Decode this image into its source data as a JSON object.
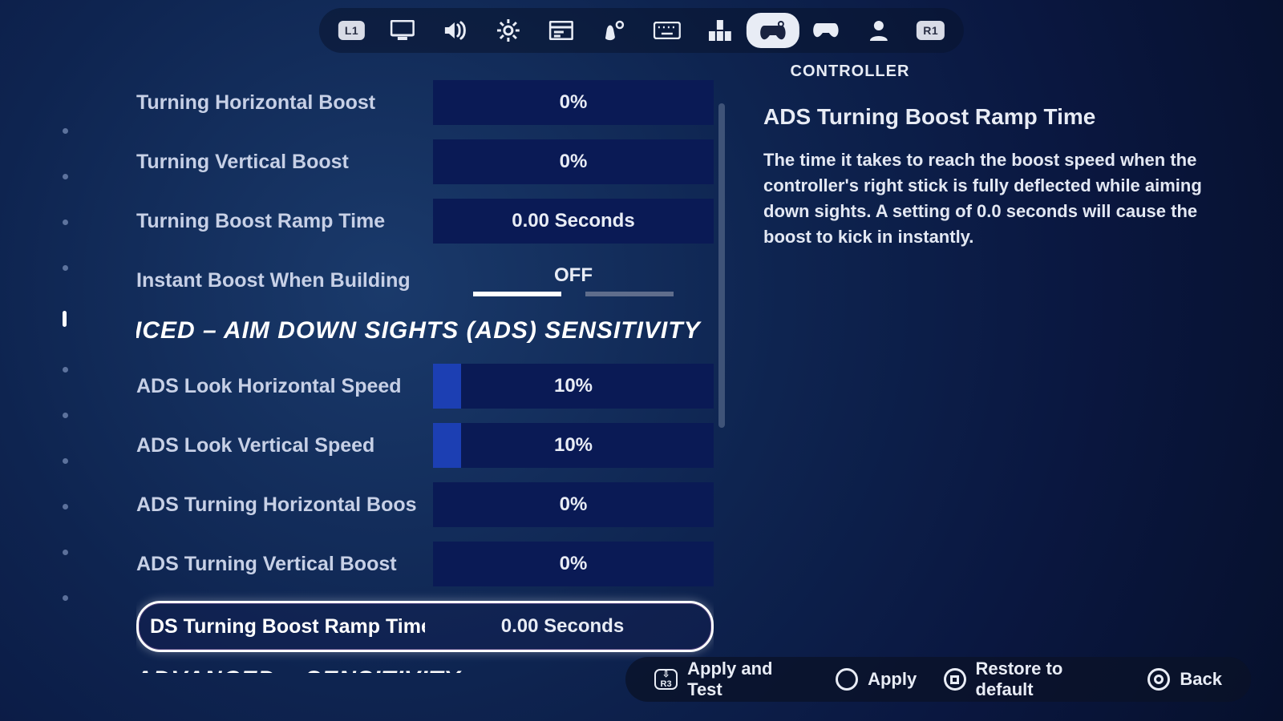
{
  "nav": {
    "left_bumper": "L1",
    "right_bumper": "R1",
    "selected_tab_label": "CONTROLLER",
    "tabs": [
      {
        "name": "video",
        "icon": "monitor"
      },
      {
        "name": "audio",
        "icon": "speaker"
      },
      {
        "name": "game",
        "icon": "gear"
      },
      {
        "name": "hud",
        "icon": "browser"
      },
      {
        "name": "touch",
        "icon": "hand-gear"
      },
      {
        "name": "keyboard",
        "icon": "keyboard"
      },
      {
        "name": "buildmap",
        "icon": "grid"
      },
      {
        "name": "controller",
        "icon": "gamepad-gear",
        "selected": true
      },
      {
        "name": "controller2",
        "icon": "gamepad"
      },
      {
        "name": "account",
        "icon": "user"
      }
    ]
  },
  "side_sections": {
    "count": 11,
    "current_index": 4
  },
  "scrollbar": {
    "thumb_top_pct": 2,
    "thumb_height_pct": 92
  },
  "settings": {
    "group1": [
      {
        "label": "Turning Horizontal Boost",
        "value": "0%",
        "fill_pct": 0
      },
      {
        "label": "Turning Vertical Boost",
        "value": "0%",
        "fill_pct": 0
      },
      {
        "label": "Turning Boost Ramp Time",
        "value": "0.00 Seconds",
        "fill_pct": 0
      }
    ],
    "toggle": {
      "label": "Instant Boost When Building",
      "value": "OFF",
      "on": false
    },
    "ads_heading_truncated": "ICED – AIM DOWN SIGHTS (ADS) SENSITIVITY",
    "group2": [
      {
        "label": "ADS Look Horizontal Speed",
        "value": "10%",
        "fill_pct": 10
      },
      {
        "label": "ADS Look Vertical Speed",
        "value": "10%",
        "fill_pct": 10
      },
      {
        "label": "ADS Turning Horizontal Boos",
        "value": "0%",
        "fill_pct": 0
      },
      {
        "label": "ADS Turning Vertical Boost",
        "value": "0%",
        "fill_pct": 0
      }
    ],
    "selected_row": {
      "label_truncated": "DS Turning Boost Ramp Time",
      "value": "0.00 Seconds"
    },
    "next_heading": "ADVANCED – SENSITIVITY"
  },
  "help": {
    "title": "ADS Turning Boost Ramp Time",
    "body": "The time it takes to reach the boost speed when the controller's right stick is fully deflected while aiming down sights.  A setting of 0.0 seconds will cause the boost to kick in instantly."
  },
  "footer": {
    "apply_test": "Apply and Test",
    "apply": "Apply",
    "restore": "Restore to default",
    "back": "Back",
    "r3_label": "R3"
  }
}
